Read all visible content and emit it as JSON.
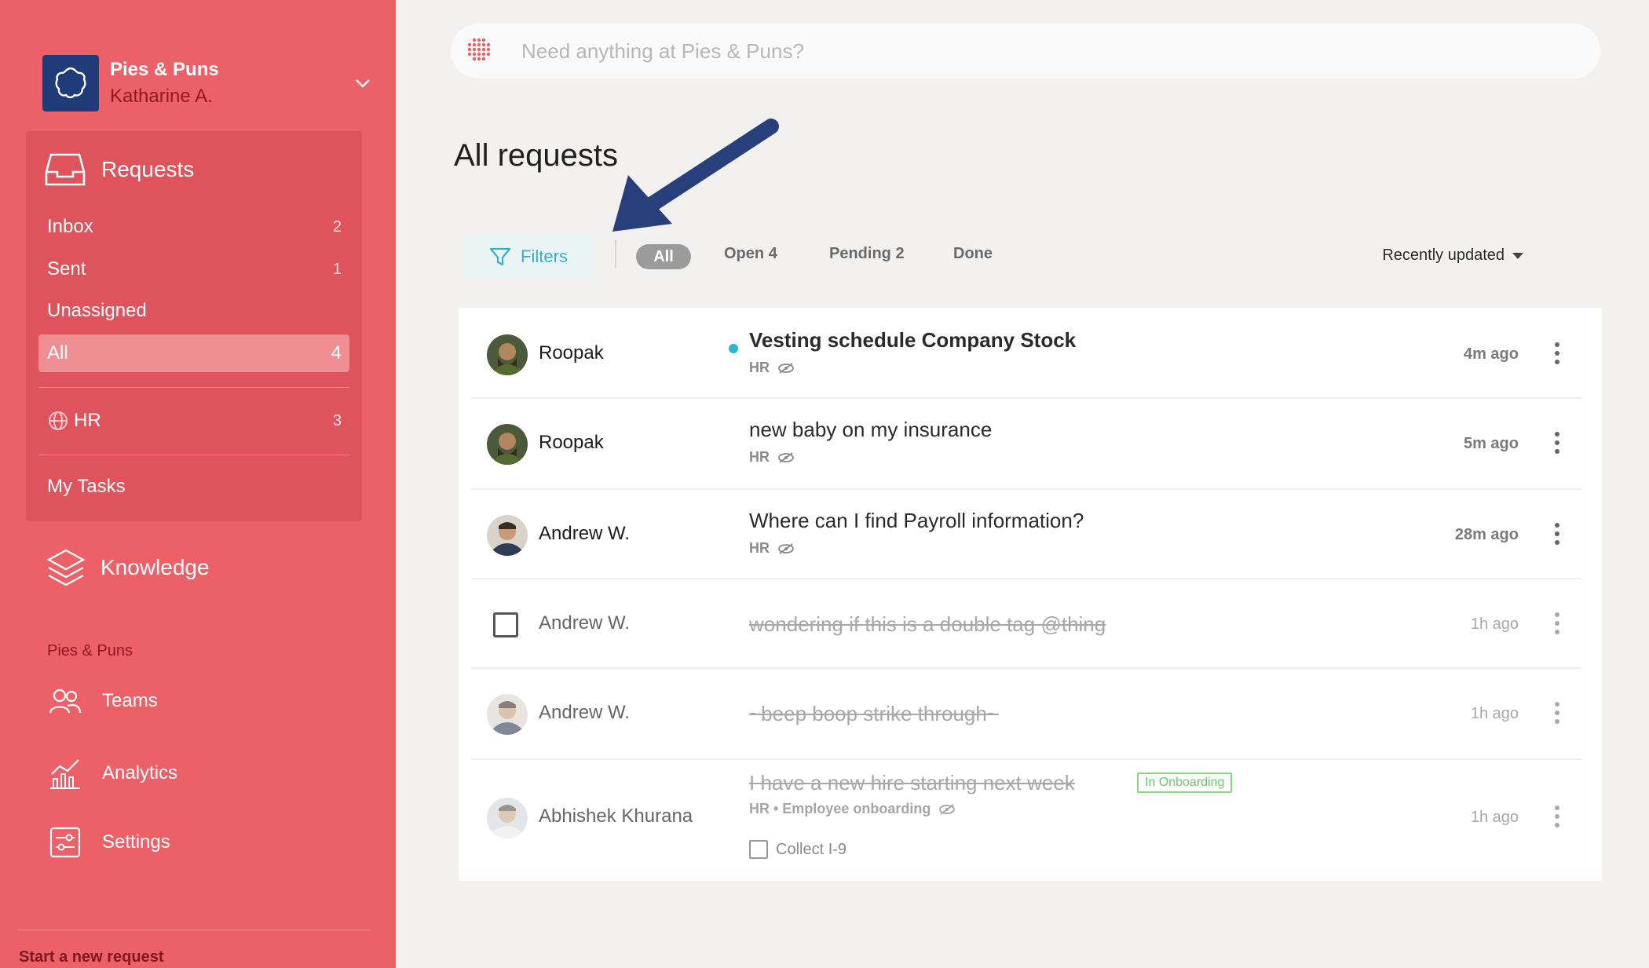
{
  "org": {
    "name": "Pies & Puns",
    "user": "Katharine A."
  },
  "sidebar": {
    "requests_label": "Requests",
    "items": [
      {
        "label": "Inbox",
        "count": "2"
      },
      {
        "label": "Sent",
        "count": "1"
      },
      {
        "label": "Unassigned",
        "count": ""
      },
      {
        "label": "All",
        "count": "4"
      },
      {
        "label": "HR",
        "count": "3"
      },
      {
        "label": "My Tasks",
        "count": ""
      }
    ],
    "knowledge_label": "Knowledge",
    "section_title": "Pies & Puns",
    "links": [
      {
        "label": "Teams",
        "icon": "teams-icon"
      },
      {
        "label": "Analytics",
        "icon": "analytics-icon"
      },
      {
        "label": "Settings",
        "icon": "settings-icon"
      }
    ],
    "start_request": "Start a new request"
  },
  "search": {
    "placeholder": "Need anything at Pies & Puns?"
  },
  "page_title": "All requests",
  "toolbar": {
    "filters_label": "Filters",
    "tabs": [
      {
        "label": "All"
      },
      {
        "label": "Open",
        "count": "4"
      },
      {
        "label": "Pending",
        "count": "2"
      },
      {
        "label": "Done"
      }
    ],
    "sort_label": "Recently updated"
  },
  "requests": [
    {
      "person": "Roopak",
      "subject": "Vesting schedule Company Stock",
      "meta": "HR",
      "time": "4m ago",
      "unread": true
    },
    {
      "person": "Roopak",
      "subject": "new baby on my insurance",
      "meta": "HR",
      "time": "5m ago"
    },
    {
      "person": "Andrew W.",
      "subject": "Where can I find Payroll information?",
      "meta": "HR",
      "time": "28m ago"
    },
    {
      "person": "Andrew W.",
      "subject": "wondering if this is a double tag @thing",
      "time": "1h ago",
      "done": true
    },
    {
      "person": "Andrew W.",
      "subject": "~beep boop strike through~",
      "time": "1h ago",
      "done": true
    },
    {
      "person": "Abhishek Khurana",
      "subject": "I have a new hire starting next week",
      "badge": "In Onboarding",
      "meta": "HR • Employee onboarding",
      "subtask": "Collect I-9",
      "time": "1h ago",
      "done": true
    }
  ],
  "colors": {
    "sidebar": "#ec6068",
    "accent": "#35b1c8",
    "arrow": "#273f7a",
    "unread": "#29b7d3"
  }
}
